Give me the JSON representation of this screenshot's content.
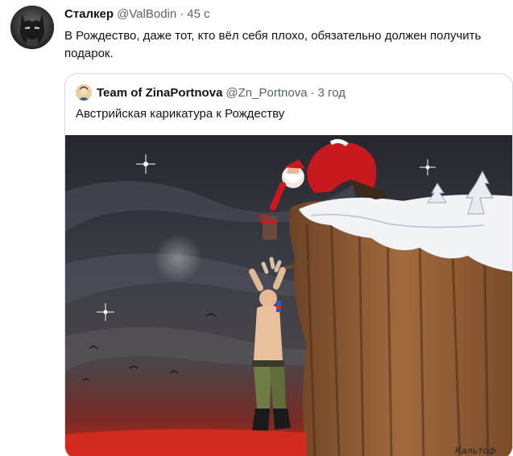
{
  "tweet": {
    "author_name": "Сталкер",
    "author_handle": "@ValBodin",
    "separator": "·",
    "time": "45 с",
    "text": "В Рождество, даже тот, кто вёл себя плохо, обязательно должен получить подарок.",
    "avatar_icon": "batman-mask-avatar"
  },
  "quote": {
    "author_name": "Team of ZinaPortnova",
    "author_handle": "@Zn_Portnova",
    "separator": "·",
    "time": "3 год",
    "text": "Австрийская карикатура к Рождеству",
    "avatar_icon": "portrait-avatar",
    "image": {
      "kind": "cartoon",
      "signature": "Кальтоф"
    }
  },
  "colors": {
    "text_primary": "#0f1419",
    "text_secondary": "#536471",
    "border": "#cfd9de",
    "sky": "#2b2d36",
    "cliff": "#8a5a36",
    "santa_red": "#c8191e",
    "ground_glow": "#d62a1e"
  }
}
